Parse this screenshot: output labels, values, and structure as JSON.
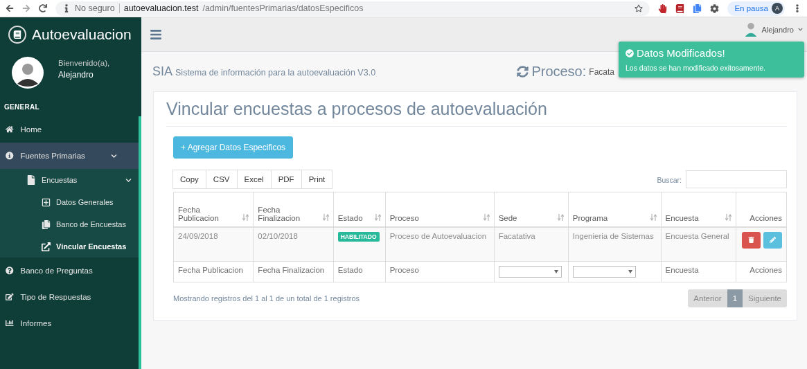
{
  "browser": {
    "security": "No seguro",
    "host": "autoevaluacion.test",
    "path": "/admin/fuentesPrimarias/datosEspecificos",
    "profile_status": "En pausa",
    "profile_initial": "A"
  },
  "sidebar": {
    "brand": "Autoevaluacion",
    "welcome": "Bienvenido(a),",
    "user": "Alejandro",
    "section": "GENERAL",
    "items": [
      {
        "label": "Home",
        "selected": false
      },
      {
        "label": "Fuentes Primarias",
        "selected": true,
        "expanded": true,
        "children": [
          {
            "label": "Encuestas",
            "selected": false,
            "expanded": true,
            "children": [
              {
                "label": "Datos Generales",
                "selected": false
              },
              {
                "label": "Banco de Encuestas",
                "selected": false
              },
              {
                "label": "Vincular Encuestas",
                "selected": true
              }
            ]
          }
        ]
      },
      {
        "label": "Banco de Preguntas",
        "selected": false
      },
      {
        "label": "Tipo de Respuestas",
        "selected": false
      },
      {
        "label": "Informes",
        "selected": false
      }
    ]
  },
  "header": {
    "user": "Alejandro"
  },
  "subheader": {
    "brand": "SIA",
    "subtitle": "Sistema de información para la autoevaluación V3.0",
    "process_label": "Proceso:",
    "process_value": "Facata"
  },
  "toast": {
    "title": "Datos Modificados!",
    "message": "Los datos se han modificado exitosamente."
  },
  "page": {
    "title": "Vincular encuestas a procesos de autoevaluación",
    "add_button": "+ Agregar Datos Especificos"
  },
  "export_buttons": [
    "Copy",
    "CSV",
    "Excel",
    "PDF",
    "Print"
  ],
  "search": {
    "label": "Buscar:"
  },
  "table": {
    "columns": [
      {
        "label": "Fecha Publicacion",
        "sortable": true
      },
      {
        "label": "Fecha Finalizacion",
        "sortable": true
      },
      {
        "label": "Estado",
        "sortable": true
      },
      {
        "label": "Proceso",
        "sortable": true
      },
      {
        "label": "Sede",
        "sortable": true
      },
      {
        "label": "Programa",
        "sortable": true
      },
      {
        "label": "Encuesta",
        "sortable": true
      },
      {
        "label": "Acciones",
        "sortable": false
      }
    ],
    "rows": [
      {
        "fecha_publicacion": "24/09/2018",
        "fecha_finalizacion": "02/10/2018",
        "estado": "HABILITADO",
        "proceso": "Proceso de Autoevaluacion",
        "sede": "Facatativa",
        "programa": "Ingenieria de Sistemas",
        "encuesta": "Encuesta General"
      }
    ],
    "filters": [
      {
        "kind": "text",
        "label": "Fecha Publicacion"
      },
      {
        "kind": "text",
        "label": "Fecha Finalizacion"
      },
      {
        "kind": "text",
        "label": "Estado"
      },
      {
        "kind": "text",
        "label": "Proceso"
      },
      {
        "kind": "select"
      },
      {
        "kind": "select"
      },
      {
        "kind": "text",
        "label": "Encuesta"
      },
      {
        "kind": "text",
        "label": "Acciones"
      }
    ]
  },
  "info": "Mostrando registros del 1 al 1 de un total de 1 registros",
  "pagination": [
    {
      "label": "Anterior",
      "selected": false
    },
    {
      "label": "1",
      "selected": true
    },
    {
      "label": "Siguiente",
      "selected": false
    }
  ]
}
